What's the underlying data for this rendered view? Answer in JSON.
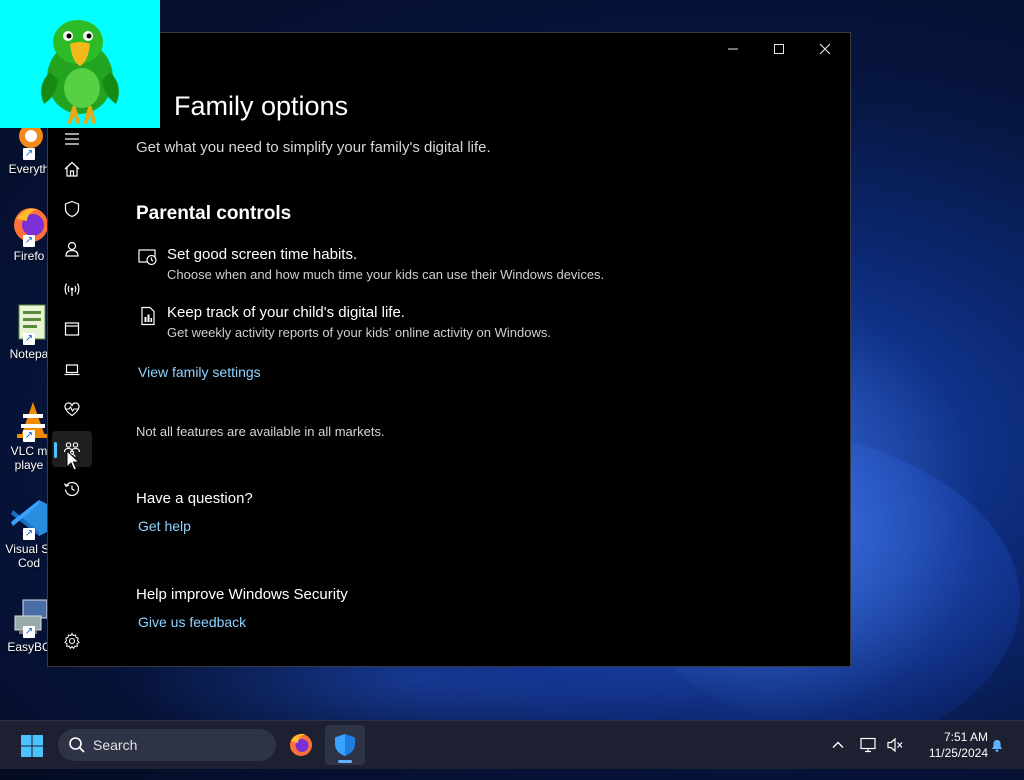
{
  "desktop": {
    "icons": [
      {
        "label": "Everyth",
        "name": "everything"
      },
      {
        "label": "Firefo",
        "name": "firefox"
      },
      {
        "label": "Notepa",
        "name": "notepad"
      },
      {
        "label": "VLC m",
        "label2": "playe",
        "name": "vlc"
      },
      {
        "label": "Visual St",
        "label2": "Cod",
        "name": "vscode"
      },
      {
        "label": "EasyBC",
        "name": "easybcd"
      }
    ]
  },
  "window": {
    "title_controls": {
      "minimize": "minimize-icon",
      "maximize": "maximize-icon",
      "close": "close-icon"
    },
    "sidebar": {
      "items": [
        {
          "name": "home",
          "icon": "home-icon"
        },
        {
          "name": "virus-threat-protection",
          "icon": "shield-icon"
        },
        {
          "name": "account-protection",
          "icon": "person-icon"
        },
        {
          "name": "firewall-network",
          "icon": "antenna-icon"
        },
        {
          "name": "app-browser-control",
          "icon": "app-window-icon"
        },
        {
          "name": "device-security",
          "icon": "laptop-icon"
        },
        {
          "name": "device-performance-health",
          "icon": "heart-pulse-icon"
        },
        {
          "name": "family-options",
          "icon": "family-icon",
          "active": true
        },
        {
          "name": "protection-history",
          "icon": "history-icon"
        }
      ],
      "settings_icon": "gear-icon"
    },
    "page": {
      "title": "Family options",
      "subtitle": "Get what you need to simplify your family's digital life.",
      "parental_heading": "Parental controls",
      "features": [
        {
          "title": "Set good screen time habits.",
          "desc": "Choose when and how much time your kids can use their Windows devices.",
          "icon": "screen-time-icon"
        },
        {
          "title": "Keep track of your child's digital life.",
          "desc": "Get weekly activity reports of your kids' online activity on Windows.",
          "icon": "activity-report-icon"
        }
      ],
      "view_family_link": "View family settings",
      "markets_note": "Not all features are available in all markets.",
      "question_heading": "Have a question?",
      "get_help_link": "Get help",
      "improve_heading": "Help improve Windows Security",
      "feedback_link": "Give us feedback"
    }
  },
  "taskbar": {
    "search_placeholder": "Search",
    "time": "7:51 AM",
    "date": "11/25/2024",
    "accent": "#60b4ff"
  }
}
